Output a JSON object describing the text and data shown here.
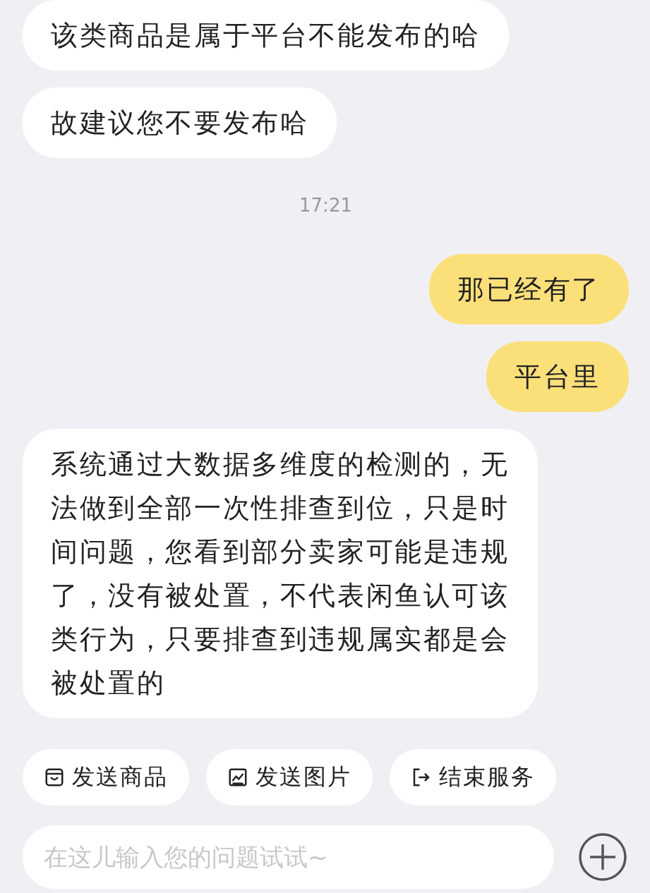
{
  "messages": [
    {
      "kind": "incoming",
      "text": "该类商品是属于平台不能发布的哈"
    },
    {
      "kind": "incoming",
      "text": "故建议您不要发布哈"
    },
    {
      "kind": "time",
      "text": "17:21"
    },
    {
      "kind": "outgoing",
      "text": "那已经有了"
    },
    {
      "kind": "outgoing",
      "text": "平台里"
    },
    {
      "kind": "incoming",
      "text": "系统通过大数据多维度的检测的，无法做到全部一次性排查到位，只是时间问题，您看到部分卖家可能是违规了，没有被处置，不代表闲鱼认可该类行为，只要排查到违规属实都是会被处置的"
    }
  ],
  "quick_actions": [
    {
      "kind": "product",
      "label": "发送商品"
    },
    {
      "kind": "image",
      "label": "发送图片"
    },
    {
      "kind": "exit",
      "label": "结束服务"
    }
  ],
  "input": {
    "placeholder": "在这儿输入您的问题试试~"
  }
}
